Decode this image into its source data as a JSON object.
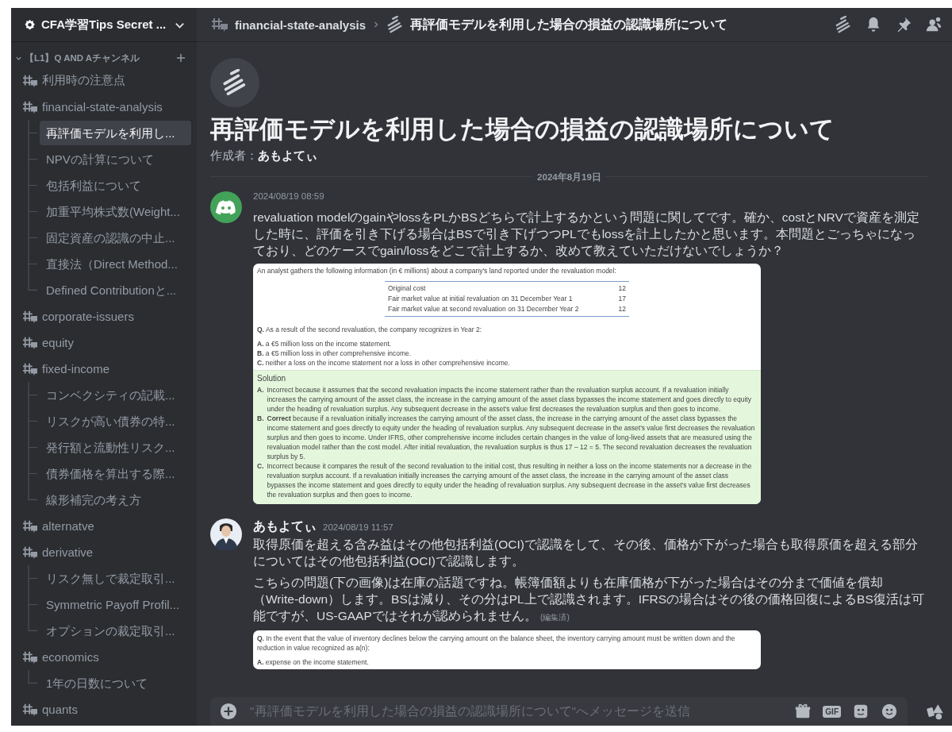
{
  "server": {
    "name": "CFA学習Tips Secret ..."
  },
  "sidebar": {
    "category": {
      "name": "【L1】Q AND Aチャンネル",
      "expanded": true
    },
    "channels": [
      {
        "name": "利用時の注意点"
      },
      {
        "name": "financial-state-analysis",
        "children": [
          {
            "name": "再評価モデルを利用し...",
            "selected": true
          },
          {
            "name": "NPVの計算について",
            "selected": false
          },
          {
            "name": "包括利益について",
            "selected": false
          },
          {
            "name": "加重平均株式数(Weight...",
            "selected": false
          },
          {
            "name": "固定資産の認識の中止...",
            "selected": false
          },
          {
            "name": "直接法（Direct Method...",
            "selected": false
          },
          {
            "name": "Defined Contributionと...",
            "selected": false
          }
        ]
      },
      {
        "name": "corporate-issuers"
      },
      {
        "name": "equity"
      },
      {
        "name": "fixed-income",
        "children": [
          {
            "name": "コンベクシティの記載...",
            "selected": false
          },
          {
            "name": "リスクが高い債券の特...",
            "selected": false
          },
          {
            "name": "発行額と流動性リスク...",
            "selected": false
          },
          {
            "name": "債券価格を算出する際...",
            "selected": false
          },
          {
            "name": "線形補完の考え方",
            "selected": false
          }
        ]
      },
      {
        "name": "alternatve"
      },
      {
        "name": "derivative",
        "children": [
          {
            "name": "リスク無しで裁定取引...",
            "selected": false
          },
          {
            "name": "Symmetric Payoff Profil...",
            "selected": false
          },
          {
            "name": "オプションの裁定取引...",
            "selected": false
          }
        ]
      },
      {
        "name": "economics",
        "children": [
          {
            "name": "1年の日数について",
            "selected": false
          }
        ]
      },
      {
        "name": "quants"
      }
    ]
  },
  "header": {
    "channel": "financial-state-analysis",
    "thread": "再評価モデルを利用した場合の損益の認識場所について"
  },
  "thread": {
    "title": "再評価モデルを利用した場合の損益の認識場所について",
    "creator": "作成者：**あもよてぃ**",
    "date": "2024年8月19日"
  },
  "messages": [
    {
      "kind": "logo",
      "time": "2024/08/19 08:59",
      "paragraphs": [
        "revaluation modelのgainやlossをPLかBSどちらで計上するかという問題に関してです。確か、costとNRVで資産を測定した時に、評価を引き下げる場合はBSで引き下げつつPLでもlossを計上したかと思います。本問題とごっちゃになっており、どのケースでgain/lossをどこで計上するか、改めて教えていただけないでしょうか？"
      ],
      "attachment": {
        "intro": "An analyst gathers the following information (in € millions) about a company's land reported under the revaluation model:",
        "table": [
          [
            "Original cost",
            "12"
          ],
          [
            "Fair market value at initial revaluation on 31 December Year 1",
            "17"
          ],
          [
            "Fair market value at second revaluation on 31 December Year 2",
            "12"
          ]
        ],
        "question": {
          "label": "Q.",
          "text": "As a result of the second revaluation, the company recognizes in Year 2:"
        },
        "options": [
          {
            "label": "A.",
            "text": "a €5 million loss on the income statement."
          },
          {
            "label": "B.",
            "text": "a €5 million loss in other comprehensive income."
          },
          {
            "label": "C.",
            "text": "neither a loss on the income statement nor a loss in other comprehensive income."
          }
        ],
        "solution": {
          "heading": "Solution",
          "items": [
            {
              "label": "A.",
              "text": "Incorrect because it assumes that the second revaluation impacts the income statement rather than the revaluation surplus account. If a revaluation initially increases the carrying amount of the asset class, the increase in the carrying amount of the asset class bypasses the income statement and goes directly to equity under the heading of revaluation surplus. Any subsequent decrease in the asset's value first decreases the revaluation surplus and then goes to income."
            },
            {
              "label": "B.",
              "text": "**Correct** because if a revaluation initially increases the carrying amount of the asset class, the increase in the carrying amount of the asset class bypasses the income statement and goes directly to equity under the heading of revaluation surplus. Any subsequent decrease in the asset's value first decreases the revaluation surplus and then goes to income. Under IFRS, other comprehensive income includes certain changes in the value of long-lived assets that are measured using the revaluation model rather than the cost model. After initial revaluation, the revaluation surplus is thus 17 – 12 = 5. The second revaluation decreases the revaluation surplus by 5."
            },
            {
              "label": "C.",
              "text": "Incorrect because it compares the result of the second revaluation to the initial cost, thus resulting in neither a loss on the income statements nor a decrease in the revaluation surplus account. If a revaluation initially increases the carrying amount of the asset class, the increase in the carrying amount of the asset class bypasses the income statement and goes directly to equity under the heading of revaluation surplus. Any subsequent decrease in the asset's value first decreases the revaluation surplus and then goes to income."
            }
          ]
        }
      }
    },
    {
      "kind": "person",
      "author": "あもよてぃ",
      "time": "2024/08/19 11:57",
      "paragraphs": [
        "取得原価を超える含み益はその他包括利益(OCI)で認識をして、その後、価格が下がった場合も取得原価を超える部分についてはその他包括利益(OCI)で認識します。",
        "こちらの問題(下の画像)は在庫の話題ですね。帳簿価額よりも在庫価格が下がった場合はその分まで価値を償却（Write-down）します。BSは減り、その分はPL上で認識されます。IFRSの場合はその後の価格回復によるBS復活は可能ですが、US-GAAPではそれが認められません。"
      ],
      "edited": "(編集済)",
      "attachment": {
        "question": {
          "label": "Q.",
          "text": "In the event that the value of inventory declines below the carrying amount on the balance sheet, the inventory carrying amount must be written down and the reduction in value recognized as a(n):"
        },
        "options": [
          {
            "label": "A.",
            "text": "expense on the income statement."
          }
        ]
      }
    }
  ],
  "composer": {
    "placeholder": "\"再評価モデルを利用した場合の損益の認識場所について\"へメッセージを送信",
    "gif_label": "GIF"
  }
}
